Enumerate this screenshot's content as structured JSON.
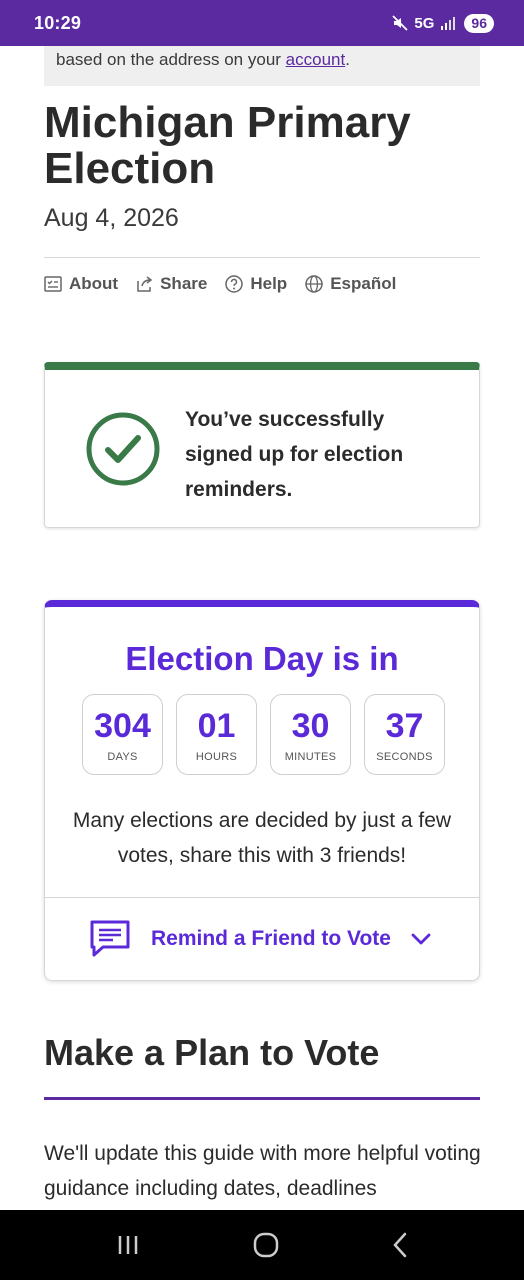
{
  "status_bar": {
    "time": "10:29",
    "network": "5G",
    "battery": "96"
  },
  "notice": {
    "text": "based on the address on your ",
    "link": "account",
    "suffix": "."
  },
  "election": {
    "title": "Michigan Primary Election",
    "date": "Aug 4, 2026"
  },
  "links": [
    {
      "label": "About",
      "icon": "about-icon"
    },
    {
      "label": "Share",
      "icon": "share-icon"
    },
    {
      "label": "Help",
      "icon": "help-icon"
    },
    {
      "label": "Español",
      "icon": "globe-icon"
    }
  ],
  "reminder": {
    "message": "You’ve successfully signed up for election reminders.",
    "icon": "checkmark-circle-icon",
    "accent": "#3a7a48"
  },
  "countdown": {
    "heading": "Election Day is in",
    "units": [
      {
        "value": "304",
        "label": "DAYS"
      },
      {
        "value": "01",
        "label": "HOURS"
      },
      {
        "value": "30",
        "label": "MINUTES"
      },
      {
        "value": "37",
        "label": "SECONDS"
      }
    ],
    "message": "Many elections are decided by just a few votes, share this with 3 friends!",
    "remind_label": "Remind a Friend to Vote",
    "accent": "#5b2ad8"
  },
  "plan": {
    "title": "Make a Plan to Vote",
    "body": "We'll update this guide with more helpful voting guidance including dates, deadlines"
  },
  "nav_bar": {
    "icons": [
      "recents-icon",
      "home-icon",
      "back-icon"
    ]
  }
}
